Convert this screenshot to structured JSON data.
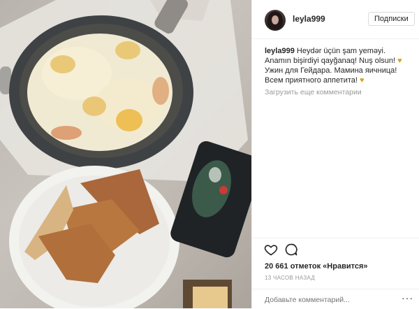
{
  "post": {
    "username": "leyla999",
    "follow_label": "Подписки",
    "caption": {
      "username": "leyla999",
      "line1": "Heydər üçün şam yeməyi. Anamın bişirdiyi qayğanaq! Nuş olsun!",
      "line2": "Ужин для Гейдара. Мамина яичница! Всем приятного аппетита!"
    },
    "load_more_comments": "Загрузить еще комментарии",
    "likes": "20 661 отметок «Нравится»",
    "time_ago": "13 ЧАСОВ НАЗАД",
    "comment_placeholder": "Добавьте комментарий...",
    "more_options": "···"
  },
  "colors": {
    "heart_emoji": "#d9a21b",
    "muted_text": "#999999",
    "border": "#efefef"
  },
  "icons": [
    "heart-icon",
    "comment-icon",
    "more-options-icon",
    "yellow-heart-emoji"
  ]
}
